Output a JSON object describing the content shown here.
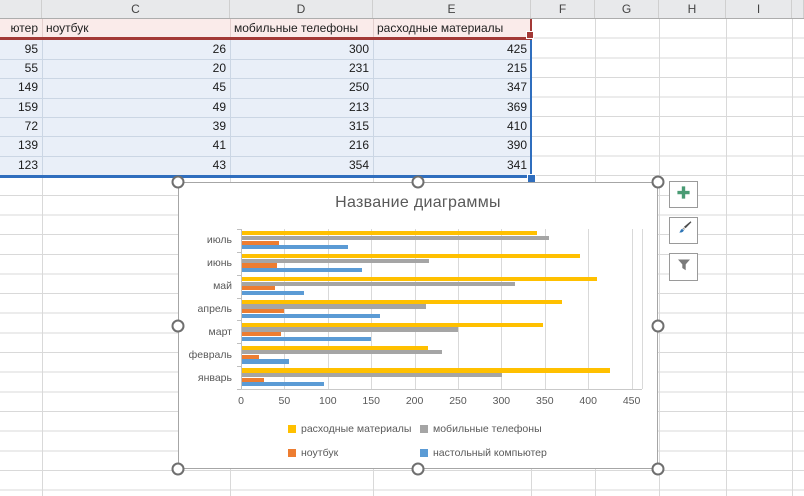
{
  "columns": [
    "C",
    "D",
    "E",
    "F",
    "G",
    "H",
    "I"
  ],
  "table": {
    "partial_header": "ютер",
    "headers": [
      "ноутбук",
      "мобильные телефоны",
      "расходные материалы"
    ],
    "rows": [
      [
        95,
        26,
        300,
        425
      ],
      [
        55,
        20,
        231,
        215
      ],
      [
        149,
        45,
        250,
        347
      ],
      [
        159,
        49,
        213,
        369
      ],
      [
        72,
        39,
        315,
        410
      ],
      [
        139,
        41,
        216,
        390
      ],
      [
        123,
        43,
        354,
        341
      ]
    ]
  },
  "chart_data": {
    "type": "bar",
    "orientation": "horizontal",
    "title": "Название диаграммы",
    "categories": [
      "июль",
      "июнь",
      "май",
      "апрель",
      "март",
      "февраль",
      "январь"
    ],
    "series": [
      {
        "name": "расходные материалы",
        "color": "#FFC000",
        "values": [
          341,
          390,
          410,
          369,
          347,
          215,
          425
        ]
      },
      {
        "name": "мобильные телефоны",
        "color": "#A5A5A5",
        "values": [
          354,
          216,
          315,
          213,
          250,
          231,
          300
        ]
      },
      {
        "name": "ноутбук",
        "color": "#ED7D31",
        "values": [
          43,
          41,
          39,
          49,
          45,
          20,
          26
        ]
      },
      {
        "name": "настольный компьютер",
        "color": "#5B9BD5",
        "values": [
          123,
          139,
          72,
          159,
          149,
          55,
          95
        ]
      }
    ],
    "x_ticks": [
      0,
      50,
      100,
      150,
      200,
      250,
      300,
      350,
      400,
      450
    ],
    "x_max": 462,
    "grid": true,
    "legend_position": "bottom",
    "legend_rows": [
      [
        "расходные материалы",
        "мобильные телефоны"
      ],
      [
        "ноутбук",
        "настольный компьютер"
      ]
    ]
  },
  "chart_tools": {
    "elements_icon": "plus-icon",
    "styles_icon": "paintbrush-icon",
    "filters_icon": "funnel-icon"
  },
  "colors": {
    "selection_blue": "#2F6EBE",
    "header_range_red": "#A33936",
    "header_fill_pink": "#FAEBEA",
    "data_fill_blue": "#E9EFF8",
    "plus_green": "#4A9B74",
    "brush_blue": "#2E75B6",
    "funnel_gray": "#7A7A7A"
  }
}
